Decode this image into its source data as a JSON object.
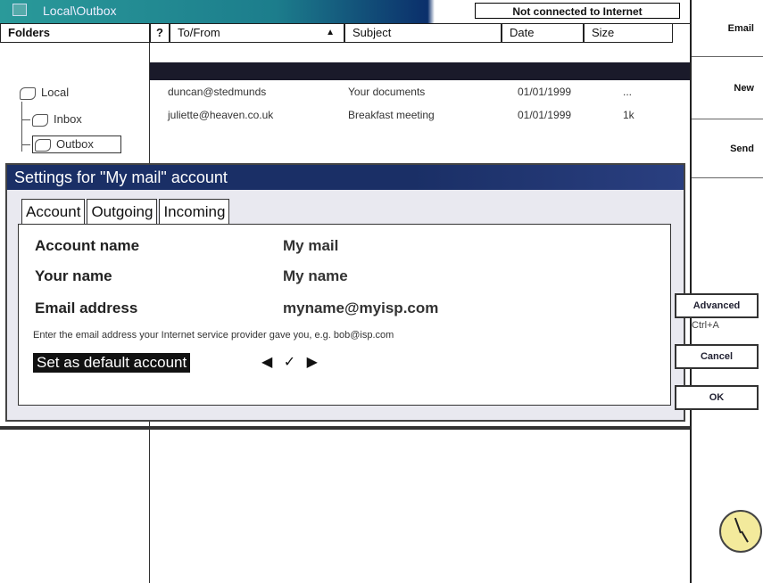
{
  "window": {
    "title": "Local\\Outbox",
    "user": "",
    "status": "Not connected to Internet"
  },
  "right_panel": {
    "buttons": [
      "Email",
      "New",
      "Send"
    ]
  },
  "columns": {
    "folders": "Folders",
    "flag": "?",
    "to_from": "To/From",
    "subject": "Subject",
    "date": "Date",
    "size": "Size"
  },
  "folders": {
    "root": "Local",
    "items": [
      "Inbox",
      "Outbox"
    ]
  },
  "messages": [
    {
      "to": "duncan@stedmunds",
      "subject": "Your documents",
      "date": "01/01/1999",
      "size": "..."
    },
    {
      "to": "juliette@heaven.co.uk",
      "subject": "Breakfast meeting",
      "date": "01/01/1999",
      "size": "1k"
    }
  ],
  "dialog": {
    "title": "Settings for \"My mail\" account",
    "tabs": [
      "Account",
      "Outgoing",
      "Incoming"
    ],
    "fields": [
      {
        "label": "Account name",
        "value": "My mail"
      },
      {
        "label": "Your name",
        "value": "My name"
      },
      {
        "label": "Email address",
        "value": "myname@myisp.com"
      }
    ],
    "hint": "Enter the email address your Internet service provider gave you, e.g. bob@isp.com",
    "default_button": "Set as default account",
    "arrows": "◀ ✓ ▶",
    "buttons": {
      "advanced": "Advanced",
      "advanced_shortcut": "Ctrl+A",
      "cancel": "Cancel",
      "ok": "OK"
    }
  },
  "colors": {
    "title_accent": "#1a2f66",
    "clock_face": "#f3ea9c"
  }
}
